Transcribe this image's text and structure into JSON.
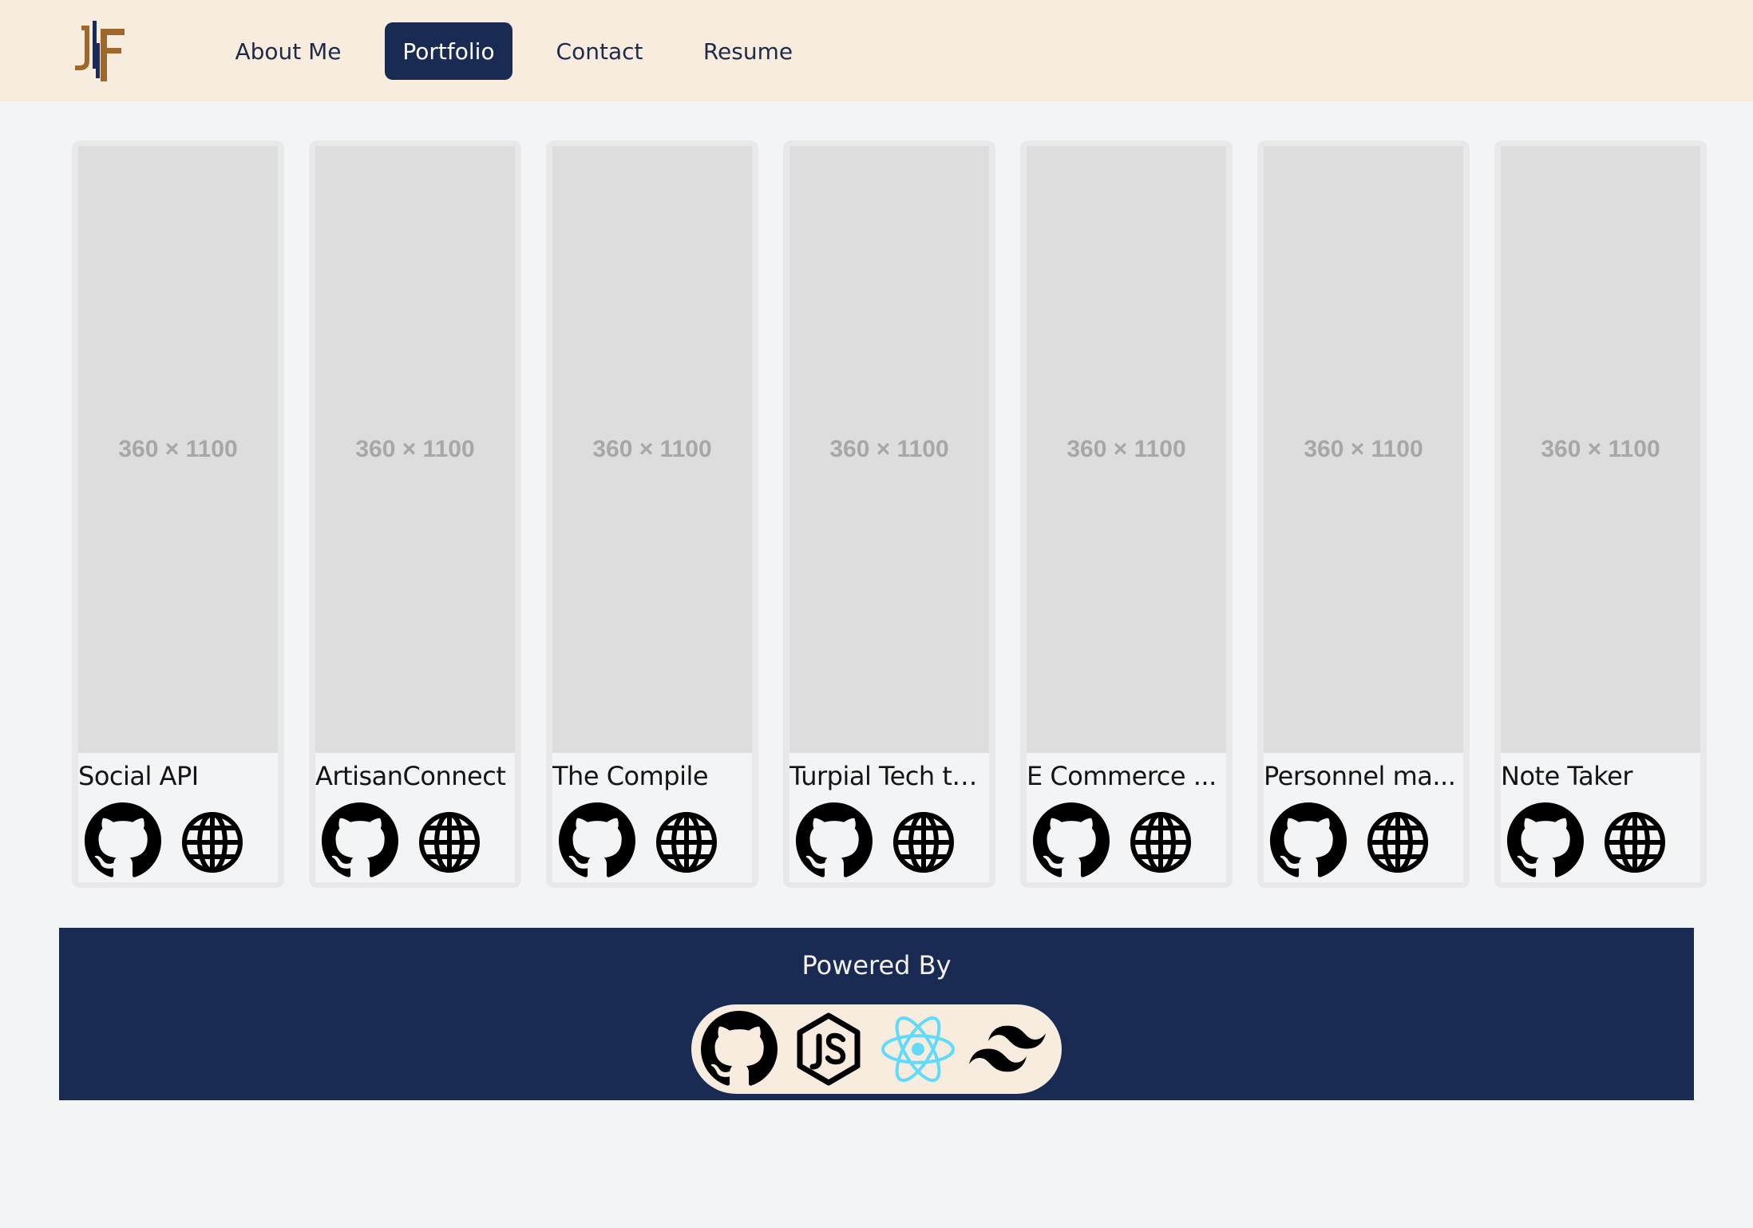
{
  "header": {
    "logo_text": "JF",
    "nav": [
      {
        "label": "About Me",
        "active": false
      },
      {
        "label": "Portfolio",
        "active": true
      },
      {
        "label": "Contact",
        "active": false
      },
      {
        "label": "Resume",
        "active": false
      }
    ]
  },
  "projects": [
    {
      "title": "Social API",
      "placeholder": "360 × 1100"
    },
    {
      "title": "ArtisanConnect",
      "placeholder": "360 × 1100"
    },
    {
      "title": "The Compile",
      "placeholder": "360 × 1100"
    },
    {
      "title": "Turpial Tech ta...",
      "placeholder": "360 × 1100"
    },
    {
      "title": "E Commerce ...",
      "placeholder": "360 × 1100"
    },
    {
      "title": "Personnel ma...",
      "placeholder": "360 × 1100"
    },
    {
      "title": "Note Taker",
      "placeholder": "360 × 1100"
    }
  ],
  "footer": {
    "heading": "Powered By",
    "tech_icons": [
      "github-icon",
      "nodejs-icon",
      "react-icon",
      "tailwind-icon"
    ]
  },
  "colors": {
    "header_bg": "#f7ecdd",
    "nav_active_bg": "#192a53",
    "footer_bg": "#192a53",
    "logo_gold": "#a0672a",
    "logo_navy": "#1c2b55",
    "react_blue": "#61dafb"
  }
}
